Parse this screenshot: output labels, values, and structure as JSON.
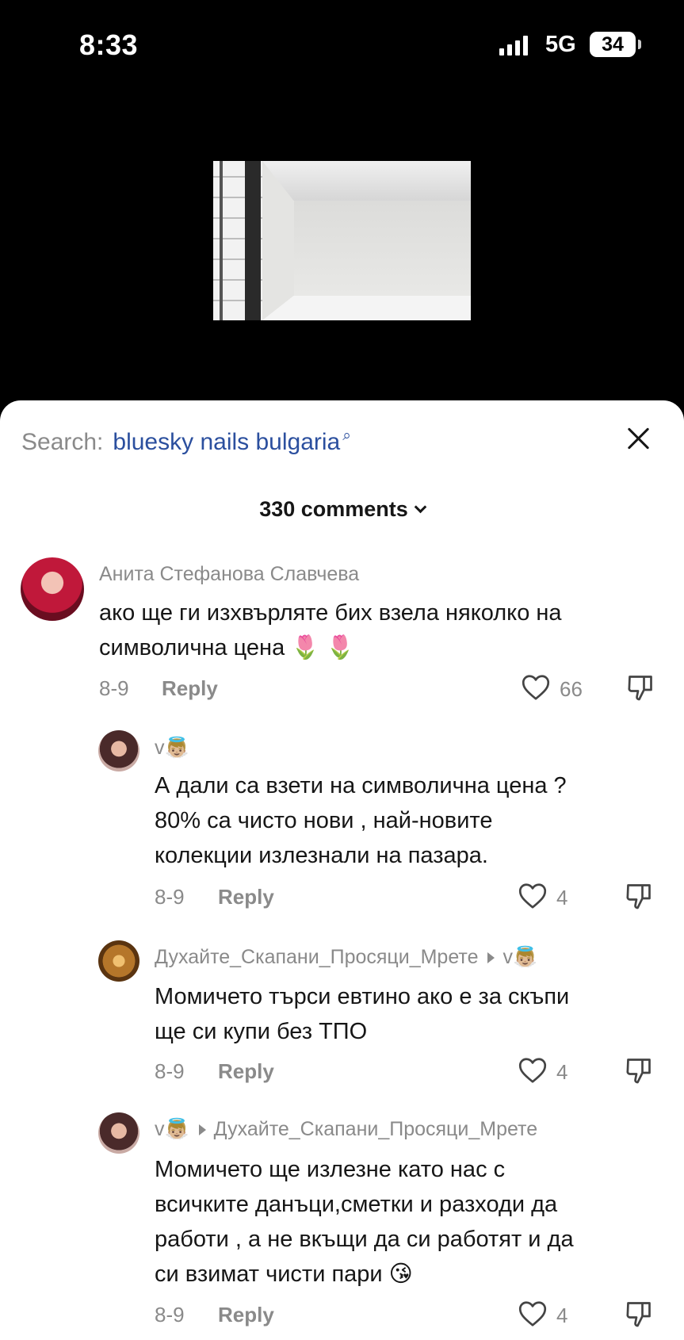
{
  "status_bar": {
    "time": "8:33",
    "network": "5G",
    "battery": "34"
  },
  "header": {
    "search_prefix": "Search:",
    "search_term": "bluesky nails bulgaria",
    "comments_count": "330 comments"
  },
  "comments": [
    {
      "author": "Анита Стефанова Славчева",
      "text_line1": "ако ще ги изхвърляте бих взела няколко на",
      "text_line2": "символична цена 🌷 🌷",
      "date": "8-9",
      "reply_label": "Reply",
      "likes": "66"
    },
    {
      "author": "v👼🏼",
      "text_line1": "А дали са взети на символична цена ?",
      "text_line2": "80% са чисто нови , най-новите",
      "text_line3": "колекции излезнали на пазара.",
      "date": "8-9",
      "reply_label": "Reply",
      "likes": "4"
    },
    {
      "author": "Духайте_Скапани_Просяци_Мрете",
      "reply_to": "v👼🏼",
      "text_line1": "Момичето търси евтино ако е за скъпи",
      "text_line2": "ще си купи без ТПО",
      "date": "8-9",
      "reply_label": "Reply",
      "likes": "4"
    },
    {
      "author": "v👼🏼",
      "reply_to": "Духайте_Скапани_Просяци_Мрете",
      "text_line1": "Момичето ще излезне като нас с",
      "text_line2": "всичките данъци,сметки и разходи да",
      "text_line3": "работи , а не вкъщи да си работят и да",
      "text_line4": "си взимат чисти пари 😘",
      "date": "8-9",
      "reply_label": "Reply",
      "likes": "4"
    }
  ]
}
